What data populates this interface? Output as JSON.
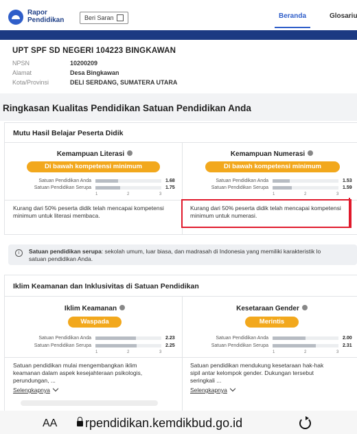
{
  "header": {
    "logo_line1": "Rapor",
    "logo_line2": "Pendidikan",
    "feedback_label": "Beri Saran",
    "tabs": [
      {
        "label": "Beranda",
        "active": true
      },
      {
        "label": "Glosariu",
        "active": false
      }
    ]
  },
  "school": {
    "name": "UPT SPF SD NEGERI 104223 BINGKAWAN",
    "rows": [
      {
        "key": "NPSN",
        "value": "10200209"
      },
      {
        "key": "Alamat",
        "value": "Desa Bingkawan"
      },
      {
        "key": "Kota/Provinsi",
        "value": "DELI SERDANG, SUMATERA UTARA"
      }
    ]
  },
  "section_title": "Ringkasan Kualitas Pendidikan Satuan Pendidikan Anda",
  "learning": {
    "title": "Mutu Hasil Belajar Peserta Didik",
    "metrics": [
      {
        "title": "Kemampuan Literasi",
        "status": "Di bawah kompetensi minimum",
        "rows": [
          {
            "label": "Satuan Pendidikan Anda",
            "value": "1.68",
            "fraction": 0.34
          },
          {
            "label": "Satuan Pendidikan Serupa",
            "value": "1.75",
            "fraction": 0.375
          }
        ],
        "scale": [
          "1",
          "2",
          "3"
        ],
        "description": "Kurang dari 50% peserta didik telah mencapai kompetensi minimum untuk literasi membaca."
      },
      {
        "title": "Kemampuan Numerasi",
        "status": "Di bawah kompetensi minimum",
        "rows": [
          {
            "label": "Satuan Pendidikan Anda",
            "value": "1.53",
            "fraction": 0.265
          },
          {
            "label": "Satuan Pendidikan Serupa",
            "value": "1.59",
            "fraction": 0.295
          }
        ],
        "scale": [
          "1",
          "2",
          "3"
        ],
        "description": "Kurang dari 50% peserta didik telah mencapai kompetensi minimum untuk numerasi."
      }
    ]
  },
  "note": {
    "bold": "Satuan pendidikan serupa",
    "text": ": sekolah umum, luar biasa, dan madrasah di Indonesia yang memiliki karakteristik lo",
    "text2": "satuan pendidikan Anda."
  },
  "climate": {
    "title": "Iklim Keamanan dan Inklusivitas di Satuan Pendidikan",
    "metrics": [
      {
        "title": "Iklim Keamanan",
        "status": "Waspada",
        "rows": [
          {
            "label": "Satuan Pendidikan Anda",
            "value": "2.23",
            "fraction": 0.615
          },
          {
            "label": "Satuan Pendidikan Serupa",
            "value": "2.25",
            "fraction": 0.625
          }
        ],
        "scale": [
          "1",
          "2",
          "3"
        ],
        "description_line1": "Satuan pendidikan mulai mengembangkan iklim",
        "description_line2": "keamanan dalam aspek kesejahteraan psikologis,",
        "description_line3": "perundungan, ...",
        "more": "Selengkapnya"
      },
      {
        "title": "Kesetaraan Gender",
        "status": "Merintis",
        "rows": [
          {
            "label": "Satuan Pendidikan Anda",
            "value": "2.00",
            "fraction": 0.5
          },
          {
            "label": "Satuan Pendidikan Serupa",
            "value": "2.31",
            "fraction": 0.655
          }
        ],
        "scale": [
          "1",
          "2",
          "3"
        ],
        "description_line1": "Satuan pendidikan mendukung kesetaraan hak-hak",
        "description_line2": "sipil antar kelompok gender. Dukungan tersebut",
        "description_line3": "seringkali ...",
        "more": "Selengkapnya"
      }
    ]
  },
  "browser": {
    "text_size": "AA",
    "url": "rpendidikan.kemdikbud.go.id"
  },
  "colors": {
    "brand_blue": "#1c3a82",
    "accent_blue": "#2f5ec9",
    "warning_orange": "#f2a81d",
    "highlight_red": "#e0192b"
  }
}
